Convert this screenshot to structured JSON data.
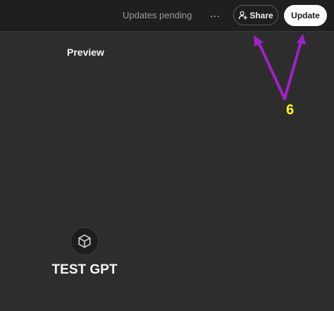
{
  "header": {
    "status_text": "Updates pending",
    "more_label": "···",
    "share_label": "Share",
    "update_label": "Update"
  },
  "preview": {
    "title": "Preview",
    "gpt_name": "TEST GPT",
    "avatar_icon": "cube-icon"
  },
  "annotation": {
    "step_number": "6",
    "color": "#a020c8",
    "number_color": "#ffff1a"
  }
}
